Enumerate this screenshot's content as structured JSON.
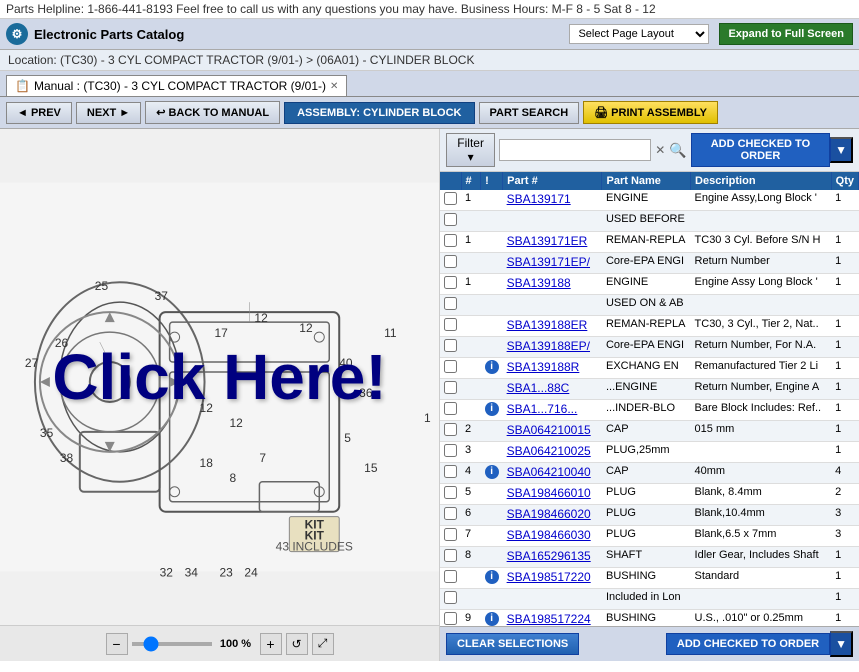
{
  "topbar": {
    "helpline": "Parts Helpline: 1-866-441-8193 Feel free to call us with any questions you may have. Business Hours: M-F 8 - 5 Sat 8 - 12"
  },
  "header": {
    "logo_text": "⚙",
    "app_title": "Electronic Parts Catalog",
    "layout_placeholder": "Select Page Layout",
    "expand_label": "Expand to Full Screen"
  },
  "breadcrumb": {
    "text": "Location: (TC30) - 3 CYL COMPACT TRACTOR (9/01-) > (06A01) - CYLINDER BLOCK"
  },
  "tab": {
    "label": "Manual : (TC30) - 3 CYL COMPACT TRACTOR (9/01-)"
  },
  "toolbar": {
    "prev_label": "◄ PREV",
    "next_label": "NEXT ►",
    "back_label": "↩ BACK TO MANUAL",
    "assembly_label": "ASSEMBLY: CYLINDER BLOCK",
    "part_search_label": "PART SEARCH",
    "print_label": "🖨 PRINT ASSEMBLY"
  },
  "filter": {
    "label": "Filter ▾",
    "placeholder": "",
    "add_checked_label": "ADD CHECKED TO ORDER"
  },
  "columns": [
    "",
    "#",
    "!",
    "Part #",
    "Part Name",
    "Description",
    "Qty"
  ],
  "parts": [
    {
      "check": "",
      "num": "1",
      "info": "",
      "part": "SBA139171",
      "name": "ENGINE",
      "desc": "Engine Assy,Long Block '",
      "qty": "1",
      "has_info": false
    },
    {
      "check": "",
      "num": "",
      "info": "",
      "part": "",
      "name": "USED BEFORE",
      "desc": "",
      "qty": "",
      "has_info": false
    },
    {
      "check": "",
      "num": "1",
      "info": "",
      "part": "SBA139171ER",
      "name": "REMAN-REPLA",
      "desc": "TC30 3 Cyl. Before S/N H",
      "qty": "1",
      "has_info": false
    },
    {
      "check": "",
      "num": "",
      "info": "",
      "part": "SBA139171EP/",
      "name": "Core-EPA ENGI",
      "desc": "Return Number",
      "qty": "1",
      "has_info": false
    },
    {
      "check": "",
      "num": "1",
      "info": "",
      "part": "SBA139188",
      "name": "ENGINE",
      "desc": "Engine Assy Long Block '",
      "qty": "1",
      "has_info": false
    },
    {
      "check": "",
      "num": "",
      "info": "",
      "part": "",
      "name": "USED ON & AB",
      "desc": "",
      "qty": "",
      "has_info": false
    },
    {
      "check": "",
      "num": "",
      "info": "",
      "part": "SBA139188ER",
      "name": "REMAN-REPLA",
      "desc": "TC30, 3 Cyl., Tier 2, Nat..",
      "qty": "1",
      "has_info": false
    },
    {
      "check": "",
      "num": "",
      "info": "",
      "part": "SBA139188EP/",
      "name": "Core-EPA ENGI",
      "desc": "Return Number, For N.A.",
      "qty": "1",
      "has_info": false
    },
    {
      "check": "",
      "num": "",
      "info": "",
      "part": "SBA139188R",
      "name": "EXCHANG EN",
      "desc": "Remanufactured Tier 2 Li",
      "qty": "1",
      "has_info": true
    },
    {
      "check": "",
      "num": "",
      "info": "",
      "part": "SBA1...88C",
      "name": "...ENGINE",
      "desc": "Return Number, Engine A",
      "qty": "1",
      "has_info": false
    },
    {
      "check": "",
      "num": "",
      "info": "",
      "part": "SBA1...716...",
      "name": "...INDER-BLO",
      "desc": "Bare Block Includes: Ref..",
      "qty": "1",
      "has_info": true
    },
    {
      "check": "",
      "num": "2",
      "info": "",
      "part": "SBA064210015",
      "name": "CAP",
      "desc": "015 mm",
      "qty": "1",
      "has_info": false
    },
    {
      "check": "",
      "num": "3",
      "info": "",
      "part": "SBA064210025",
      "name": "PLUG,25mm",
      "desc": "",
      "qty": "1",
      "has_info": false
    },
    {
      "check": "",
      "num": "4",
      "info": "i",
      "part": "SBA064210040",
      "name": "CAP",
      "desc": "40mm",
      "qty": "4",
      "has_info": true
    },
    {
      "check": "",
      "num": "5",
      "info": "",
      "part": "SBA198466010",
      "name": "PLUG",
      "desc": "Blank, 8.4mm",
      "qty": "2",
      "has_info": false
    },
    {
      "check": "",
      "num": "6",
      "info": "",
      "part": "SBA198466020",
      "name": "PLUG",
      "desc": "Blank,10.4mm",
      "qty": "3",
      "has_info": false
    },
    {
      "check": "",
      "num": "7",
      "info": "",
      "part": "SBA198466030",
      "name": "PLUG",
      "desc": "Blank,6.5 x 7mm",
      "qty": "3",
      "has_info": false
    },
    {
      "check": "",
      "num": "8",
      "info": "",
      "part": "SBA165296135",
      "name": "SHAFT",
      "desc": "Idler Gear, Includes Shaft",
      "qty": "1",
      "has_info": false
    },
    {
      "check": "",
      "num": "",
      "info": "i",
      "part": "SBA198517220",
      "name": "BUSHING",
      "desc": "Standard",
      "qty": "1",
      "has_info": true
    },
    {
      "check": "",
      "num": "",
      "info": "",
      "part": "",
      "name": "Included in Lon",
      "desc": "",
      "qty": "1",
      "has_info": false
    },
    {
      "check": "",
      "num": "9",
      "info": "i",
      "part": "SBA198517224",
      "name": "BUSHING",
      "desc": "U.S., .010\" or 0.25mm",
      "qty": "1",
      "has_info": true
    }
  ],
  "bottom": {
    "clear_label": "CLEAR SELECTIONS",
    "add_order_label": "ADD CHECKED TO ORDER"
  },
  "diagram": {
    "click_here_text": "Click Here!",
    "zoom_level": "100 %"
  }
}
